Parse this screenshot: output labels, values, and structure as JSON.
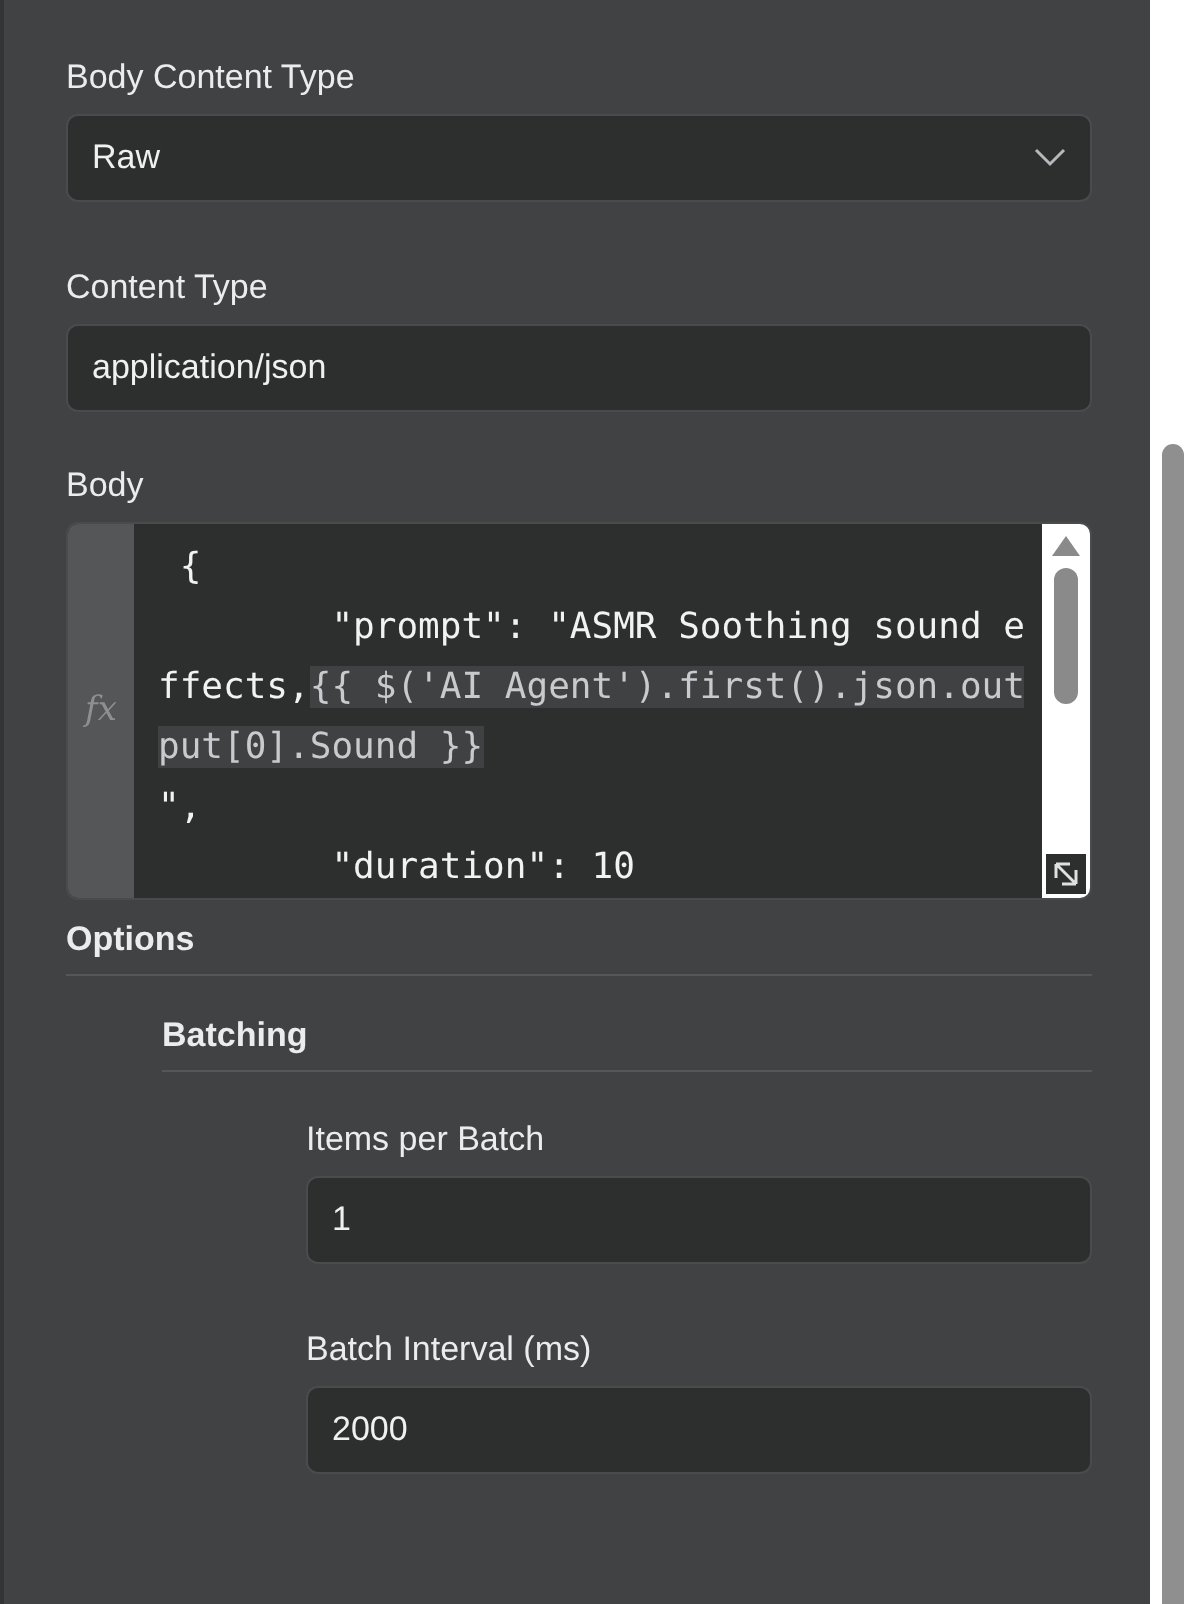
{
  "body_content_type": {
    "label": "Body Content Type",
    "value": "Raw"
  },
  "content_type": {
    "label": "Content Type",
    "value": "application/json"
  },
  "body": {
    "label": "Body",
    "gutter": "fx",
    "lines": [
      [
        {
          "kind": "plain",
          "text": " {"
        }
      ],
      [
        {
          "kind": "plain",
          "text": "        \"prompt\": \"ASMR Soothing sound e"
        }
      ],
      [
        {
          "kind": "plain",
          "text": "ffects,"
        },
        {
          "kind": "expression",
          "text": "{{ $('AI Agent').first().json.out"
        }
      ],
      [
        {
          "kind": "expression",
          "text": "put[0].Sound }}"
        }
      ],
      [
        {
          "kind": "plain",
          "text": "\","
        }
      ],
      [
        {
          "kind": "plain",
          "text": "        \"duration\": 10"
        }
      ]
    ]
  },
  "options": {
    "label": "Options",
    "batching": {
      "label": "Batching",
      "fields": [
        {
          "label": "Items per Batch",
          "value": "1"
        },
        {
          "label": "Batch Interval (ms)",
          "value": "2000"
        }
      ]
    }
  }
}
